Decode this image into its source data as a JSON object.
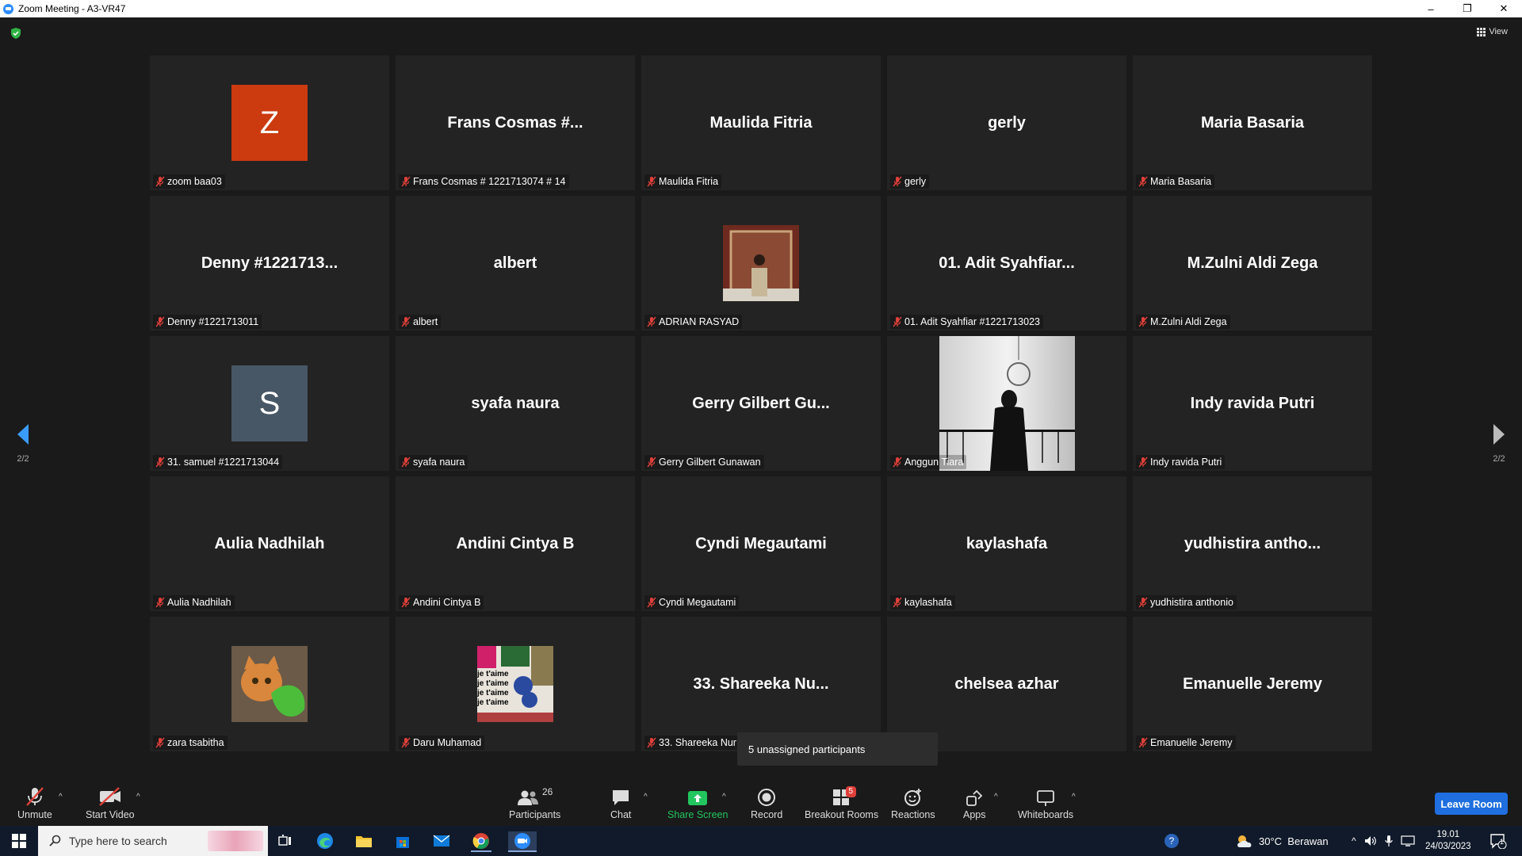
{
  "window": {
    "title": "Zoom Meeting - A3-VR47"
  },
  "top": {
    "view_label": "View"
  },
  "pagination": {
    "left": "2/2",
    "right": "2/2"
  },
  "tiles": [
    {
      "big": "",
      "caption": "zoom baa03",
      "avatar": "Z",
      "avatar_color": "#cc3a10"
    },
    {
      "big": "Frans Cosmas #...",
      "caption": "Frans Cosmas # 1221713074 # 14"
    },
    {
      "big": "Maulida Fitria",
      "caption": "Maulida Fitria"
    },
    {
      "big": "gerly",
      "caption": "gerly"
    },
    {
      "big": "Maria Basaria",
      "caption": "Maria Basaria"
    },
    {
      "big": "Denny #1221713...",
      "caption": "Denny #1221713011"
    },
    {
      "big": "albert",
      "caption": "albert"
    },
    {
      "big": "",
      "caption": "ADRIAN RASYAD",
      "photo": "person-photo"
    },
    {
      "big": "01. Adit Syahfiar...",
      "caption": "01. Adit Syahfiar #1221713023"
    },
    {
      "big": "M.Zulni Aldi Zega",
      "caption": "M.Zulni Aldi Zega"
    },
    {
      "big": "",
      "caption": "31. samuel #1221713044",
      "avatar": "S",
      "avatar_color": "#485766"
    },
    {
      "big": "syafa naura",
      "caption": "syafa naura"
    },
    {
      "big": "Gerry Gilbert Gu...",
      "caption": "Gerry Gilbert Gunawan"
    },
    {
      "big": "",
      "caption": "Anggun Tiara",
      "photo": "video-feed"
    },
    {
      "big": "Indy ravida Putri",
      "caption": "Indy ravida Putri"
    },
    {
      "big": "Aulia Nadhilah",
      "caption": "Aulia Nadhilah"
    },
    {
      "big": "Andini Cintya B",
      "caption": "Andini Cintya B"
    },
    {
      "big": "Cyndi Megautami",
      "caption": "Cyndi Megautami"
    },
    {
      "big": "kaylashafa",
      "caption": "kaylashafa"
    },
    {
      "big": "yudhistira antho...",
      "caption": "yudhistira anthonio"
    },
    {
      "big": "",
      "caption": "zara tsabitha",
      "photo": "cat-photo"
    },
    {
      "big": "",
      "caption": "Daru Muhamad",
      "photo": "collage-photo",
      "collage_words": "je t'aime"
    },
    {
      "big": "33. Shareeka Nu...",
      "caption": "33. Shareeka Nur"
    },
    {
      "big": "chelsea azhar",
      "caption": "azhar"
    },
    {
      "big": "Emanuelle Jeremy",
      "caption": "Emanuelle Jeremy"
    }
  ],
  "tooltip": "5 unassigned participants",
  "toolbar": {
    "unmute": "Unmute",
    "start_video": "Start Video",
    "participants": "Participants",
    "participants_count": "26",
    "chat": "Chat",
    "share_screen": "Share Screen",
    "record": "Record",
    "breakout_rooms": "Breakout Rooms",
    "breakout_badge": "5",
    "reactions": "Reactions",
    "apps": "Apps",
    "whiteboards": "Whiteboards",
    "leave": "Leave Room"
  },
  "taskbar": {
    "search_placeholder": "Type here to search",
    "weather": "30°C  Berawan",
    "time": "19.01",
    "date": "24/03/2023",
    "notif_count": "1"
  },
  "colors": {
    "accent": "#1f6fe0",
    "share_green": "#22c55e",
    "mute_red": "#e0403a",
    "badge_red": "#e0403a"
  }
}
